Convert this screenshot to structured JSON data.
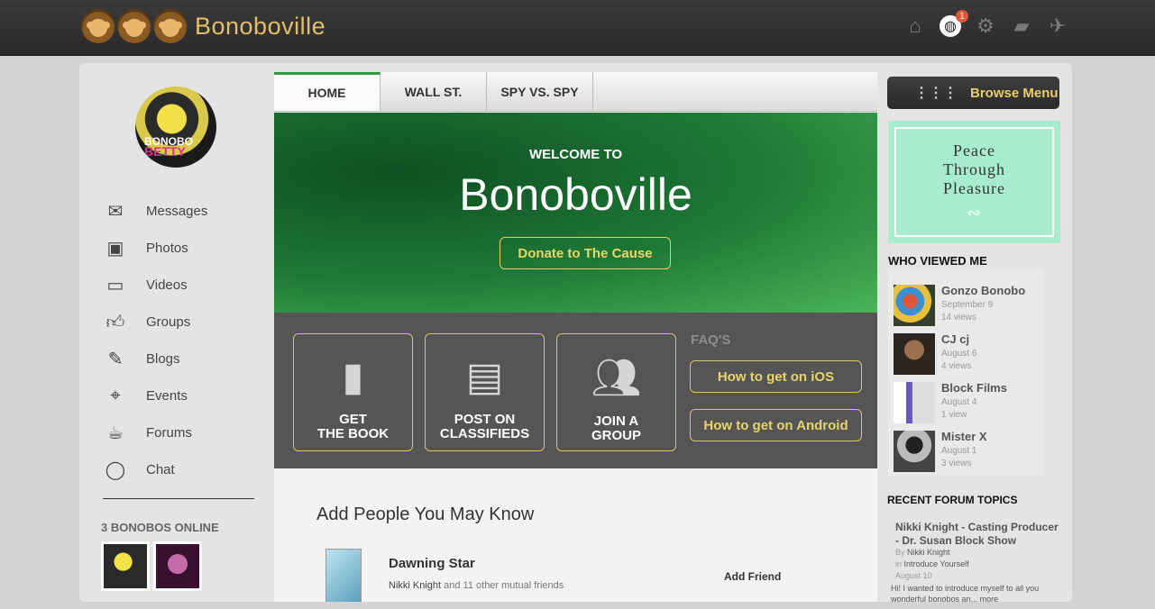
{
  "app": {
    "title": "Bonoboville"
  },
  "topbar": {
    "notification_count": "1"
  },
  "sidebar": {
    "avatar_text_1": "BONOBO",
    "avatar_text_2": "BETTY",
    "items": [
      {
        "label": "Messages",
        "icon": "envelope-icon"
      },
      {
        "label": "Photos",
        "icon": "photo-icon"
      },
      {
        "label": "Videos",
        "icon": "video-camera-icon"
      },
      {
        "label": "Groups",
        "icon": "thumbs-up-icon"
      },
      {
        "label": "Blogs",
        "icon": "pencil-icon"
      },
      {
        "label": "Events",
        "icon": "map-pin-icon"
      },
      {
        "label": "Forums",
        "icon": "cup-icon"
      },
      {
        "label": "Chat",
        "icon": "chat-bubble-icon"
      }
    ],
    "online_title": "3 BONOBOS ONLINE"
  },
  "tabs": [
    "HOME",
    "WALL ST.",
    "SPY VS. SPY"
  ],
  "hero": {
    "subtitle": "WELCOME TO",
    "title": "Bonoboville",
    "donate_label": "Donate to The Cause"
  },
  "actions": [
    {
      "label_1": "GET",
      "label_2": "THE BOOK",
      "icon": "book-icon"
    },
    {
      "label_1": "POST ON",
      "label_2": "CLASSIFIEDS",
      "icon": "newspaper-icon"
    },
    {
      "label_1": "JOIN A",
      "label_2": "GROUP",
      "icon": "group-icon"
    }
  ],
  "faq": {
    "title": "FAQ'S",
    "ios": "How to get on iOS",
    "android": "How to get on Android"
  },
  "people": {
    "heading": "Add People You May Know",
    "name": "Dawning Star",
    "mutual_name": "Nikki Knight",
    "mutual_rest": " and 11 other mutual friends",
    "add_label": "Add Friend"
  },
  "right": {
    "browse_label": "Browse Menu",
    "peace": [
      "Peace",
      "Through",
      "Pleasure"
    ],
    "who_title": "WHO VIEWED ME",
    "viewers": [
      {
        "name": "Gonzo Bonobo",
        "date": "September 9",
        "views": "14 views"
      },
      {
        "name": "CJ cj",
        "date": "August 6",
        "views": "4 views"
      },
      {
        "name": "Block Films",
        "date": "August 4",
        "views": "1 view"
      },
      {
        "name": "Mister X",
        "date": "August 1",
        "views": "3 views"
      }
    ],
    "recent_title": "RECENT FORUM TOPICS",
    "topic": {
      "title": "Nikki Knight - Casting Producer - Dr. Susan Block Show",
      "by_label": "By",
      "by": "Nikki Knight",
      "in_label": "in",
      "in": "Introduce Yourself",
      "date": "August 10",
      "snippet": "Hi! I wanted to introduce myself to all you wonderful bonobos an...",
      "more": "more"
    }
  },
  "colors": {
    "accent_green": "#2e9a3c",
    "gold": "#e2bf68",
    "badge": "#e2553b"
  }
}
